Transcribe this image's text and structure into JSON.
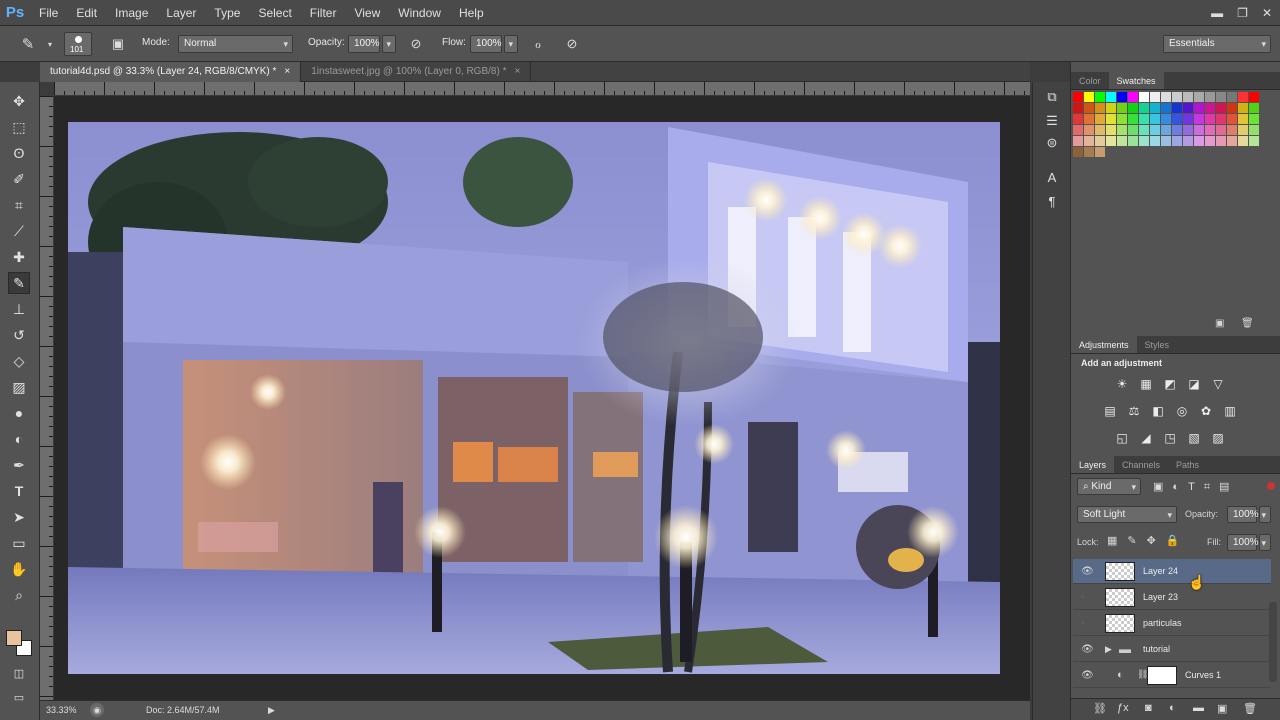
{
  "app": {
    "logo": "Ps"
  },
  "menu": [
    "File",
    "Edit",
    "Image",
    "Layer",
    "Type",
    "Select",
    "Filter",
    "View",
    "Window",
    "Help"
  ],
  "window_controls": {
    "minimize": "▬",
    "restore": "❐",
    "close": "✕"
  },
  "options_bar": {
    "brush_size": "101",
    "mode_label": "Mode:",
    "mode_value": "Normal",
    "opacity_label": "Opacity:",
    "opacity_value": "100%",
    "flow_label": "Flow:",
    "flow_value": "100%",
    "workspace": "Essentials"
  },
  "tabs": [
    {
      "label": "tutorial4d.psd @ 33.3% (Layer 24, RGB/8/CMYK) *",
      "active": true
    },
    {
      "label": "1instasweet.jpg @ 100% (Layer 0, RGB/8) *",
      "active": false
    }
  ],
  "tab_close": "×",
  "status": {
    "zoom": "33.33%",
    "doc": "Doc: 2.64M/57.4M",
    "arrow": "▶"
  },
  "color_panel": {
    "tab_color": "Color",
    "tab_swatches": "Swatches"
  },
  "adjustments_panel": {
    "tab_adjustments": "Adjustments",
    "tab_styles": "Styles",
    "heading": "Add an adjustment",
    "icons_row1": [
      "☀",
      "▦",
      "◩",
      "◪",
      "▽"
    ],
    "icons_row2": [
      "▤",
      "⚖",
      "◧",
      "◎",
      "✿",
      "▥"
    ],
    "icons_row3": [
      "◱",
      "◢",
      "◳",
      "▧",
      "▨"
    ]
  },
  "layers_panel": {
    "tab_layers": "Layers",
    "tab_channels": "Channels",
    "tab_paths": "Paths",
    "filter_kind": "Kind",
    "blend_mode": "Soft Light",
    "opacity_label": "Opacity:",
    "opacity_value": "100%",
    "lock_label": "Lock:",
    "fill_label": "Fill:",
    "fill_value": "100%",
    "layers": [
      {
        "name": "Layer 24",
        "visible": true,
        "selected": true
      },
      {
        "name": "Layer 23",
        "visible": false,
        "selected": false
      },
      {
        "name": "particulas",
        "visible": false,
        "selected": false
      },
      {
        "name": "tutorial",
        "visible": true,
        "selected": false,
        "group": true
      },
      {
        "name": "Curves 1",
        "visible": true,
        "selected": false,
        "adjustment": true
      }
    ]
  },
  "colors": {
    "foreground": "#e9c29e",
    "background": "#ffffff",
    "selection": "#586a87",
    "accent": "#5fb4ff"
  }
}
